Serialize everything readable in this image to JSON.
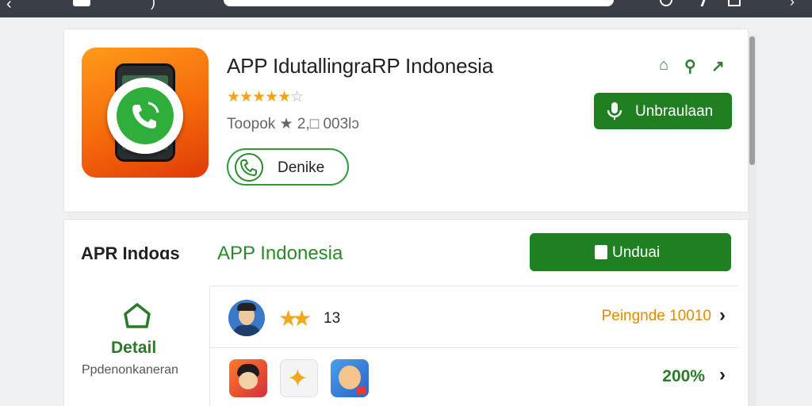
{
  "colors": {
    "accent_green": "#1e8020",
    "star_gold": "#f3a21b",
    "orange_text": "#e08a00"
  },
  "browser": {
    "icons": [
      "back-icon",
      "tab-icon",
      "reload-icon",
      "share-icon",
      "edit-icon",
      "menu-icon"
    ]
  },
  "app": {
    "title": "APP IdutallingraRP Indonesia",
    "rating_stars": "★★★★★",
    "rating_half": "☆",
    "meta": "Toopok ★ 2,□ 003lɔ",
    "pill_label": "Denike",
    "download_label": "Unbraulaan",
    "icon_name": "phone-call-app-icon"
  },
  "section": {
    "title": "APR Indoɑs",
    "subtitle": "APP Indonesia",
    "download_label": "Unduai",
    "side_label": "Detail",
    "side_sub": "Ppdenonkaneran"
  },
  "rows": [
    {
      "stars": "★★",
      "count": "13",
      "right_text": "Peingnde 10010",
      "chevron": "›"
    },
    {
      "right_text": "200%",
      "chevron": "›"
    }
  ]
}
